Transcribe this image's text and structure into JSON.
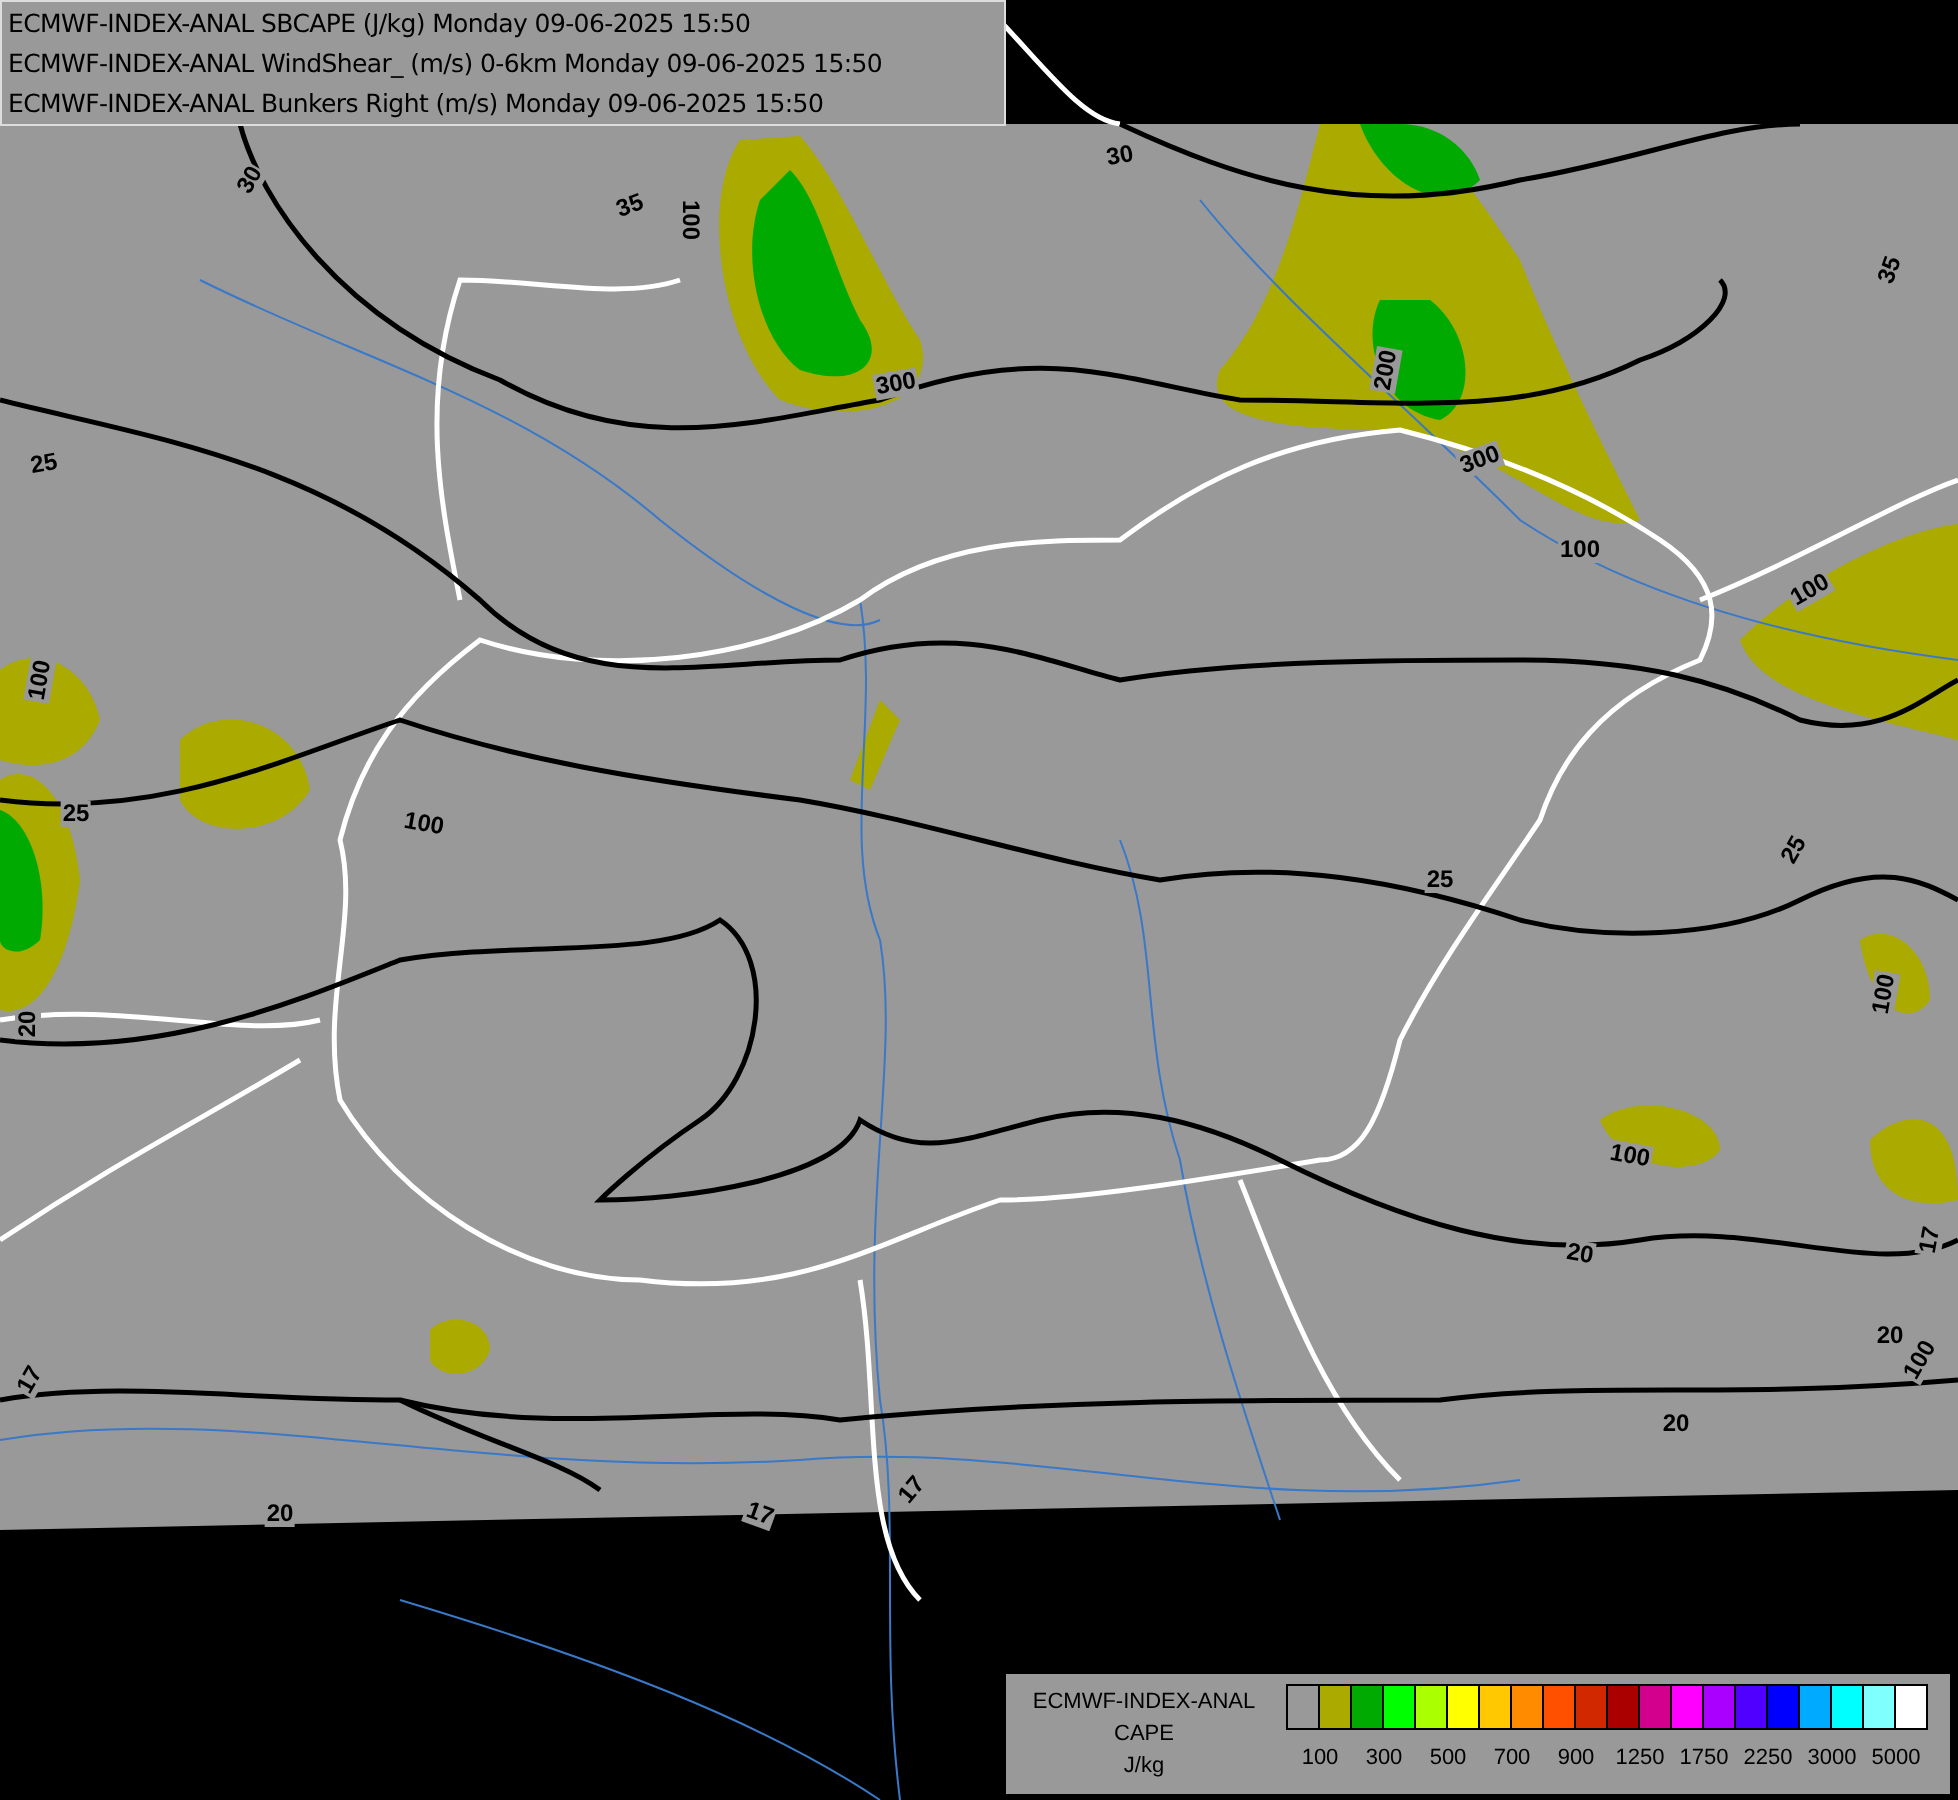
{
  "header": {
    "lines": [
      "ECMWF-INDEX-ANAL SBCAPE (J/kg) Monday 09-06-2025 15:50",
      "ECMWF-INDEX-ANAL WindShear_ (m/s) 0-6km Monday 09-06-2025 15:50",
      "ECMWF-INDEX-ANAL Bunkers Right (m/s) Monday 09-06-2025 15:50"
    ]
  },
  "map": {
    "contour_labels": [
      "30",
      "35",
      "30",
      "100",
      "300",
      "200",
      "300",
      "100",
      "35",
      "25",
      "100",
      "25",
      "100",
      "20",
      "100",
      "25",
      "25",
      "100",
      "20",
      "100",
      "17",
      "20",
      "100",
      "20",
      "17",
      "17",
      "20",
      "17"
    ]
  },
  "legend": {
    "title_lines": [
      "ECMWF-INDEX-ANAL",
      "CAPE",
      "J/kg"
    ],
    "swatches": [
      {
        "color": "#999999"
      },
      {
        "color": "#aaaa00"
      },
      {
        "color": "#00aa00"
      },
      {
        "color": "#00ff00"
      },
      {
        "color": "#aaff00"
      },
      {
        "color": "#ffff00"
      },
      {
        "color": "#ffc800"
      },
      {
        "color": "#ff8c00"
      },
      {
        "color": "#ff5000"
      },
      {
        "color": "#d22800"
      },
      {
        "color": "#aa0000"
      },
      {
        "color": "#d2008c"
      },
      {
        "color": "#ff00ff"
      },
      {
        "color": "#aa00ff"
      },
      {
        "color": "#5000ff"
      },
      {
        "color": "#0000ff"
      },
      {
        "color": "#00aaff"
      },
      {
        "color": "#00ffff"
      },
      {
        "color": "#80ffff"
      },
      {
        "color": "#ffffff"
      }
    ],
    "ticks": [
      "100",
      "300",
      "500",
      "700",
      "900",
      "1250",
      "1750",
      "2250",
      "3000",
      "5000"
    ]
  }
}
